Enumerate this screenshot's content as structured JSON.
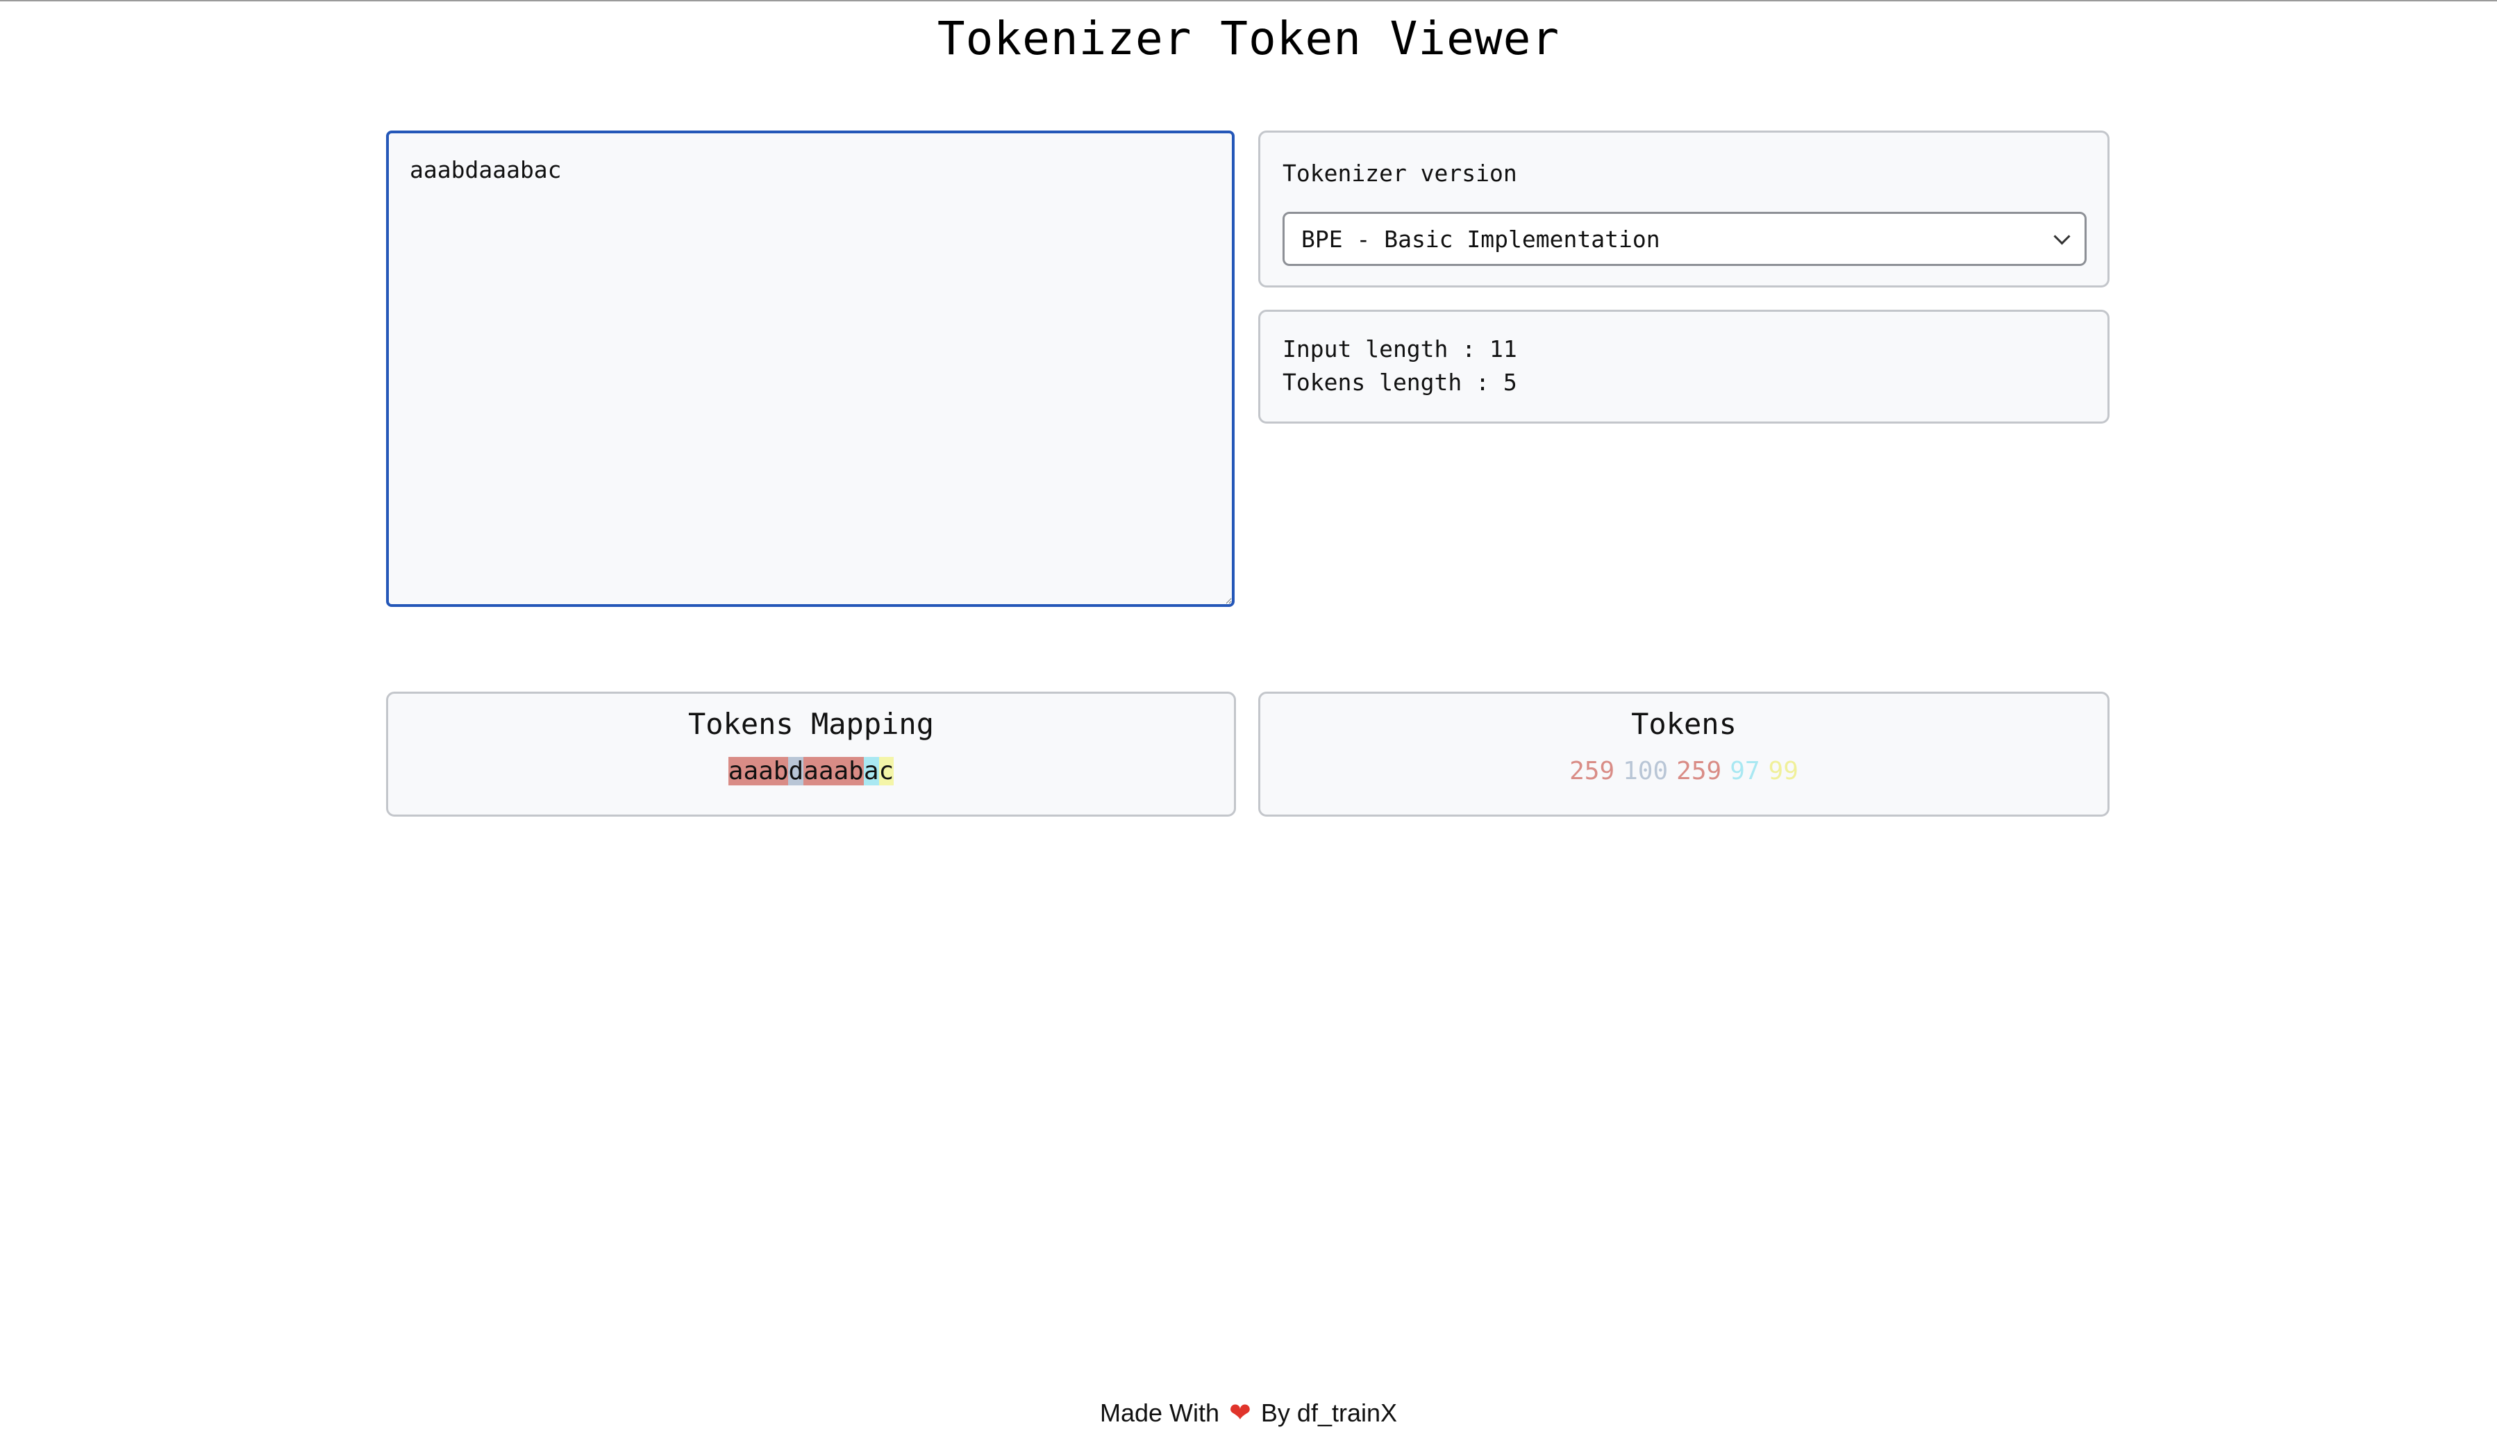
{
  "app": {
    "title": "Tokenizer Token Viewer"
  },
  "input": {
    "value": "aaabdaaabac"
  },
  "tokenizer": {
    "label": "Tokenizer version",
    "selected": "BPE - Basic Implementation"
  },
  "stats": {
    "input_length": "Input length : 11",
    "tokens_length": "Tokens length : 5"
  },
  "mapping": {
    "title": "Tokens Mapping",
    "segments": [
      {
        "text": "aaab",
        "color": "#d98c86"
      },
      {
        "text": "d",
        "color": "#b9c6d6"
      },
      {
        "text": "aaab",
        "color": "#d98c86"
      },
      {
        "text": "a",
        "color": "#a9e8f2"
      },
      {
        "text": "c",
        "color": "#f4f5a8"
      }
    ]
  },
  "tokens": {
    "title": "Tokens",
    "items": [
      {
        "id": "259",
        "color": "#d98c86"
      },
      {
        "id": "100",
        "color": "#b9c6d6"
      },
      {
        "id": "259",
        "color": "#d98c86"
      },
      {
        "id": "97",
        "color": "#a9e8f2"
      },
      {
        "id": "99",
        "color": "#f0f09a"
      }
    ]
  },
  "footer": {
    "made_with": "Made With",
    "heart": "❤",
    "by": "By df_trainX"
  }
}
